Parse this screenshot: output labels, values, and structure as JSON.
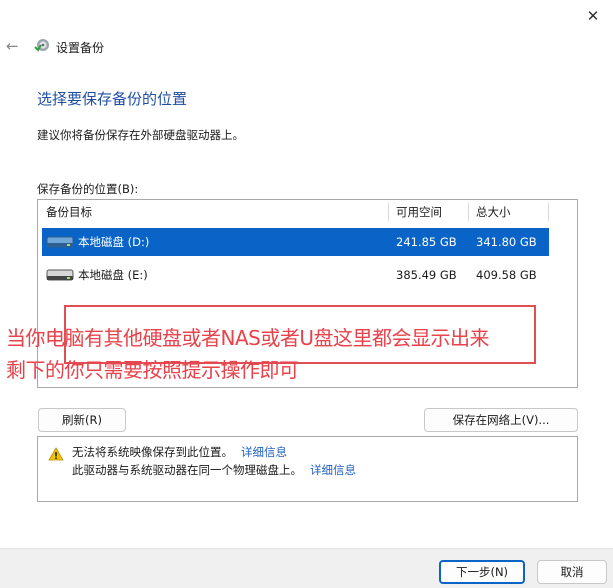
{
  "window": {
    "title": "设置备份",
    "close_glyph": "✕",
    "back_glyph": "←"
  },
  "page": {
    "heading": "选择要保存备份的位置",
    "description": "建议你将备份保存在外部硬盘驱动器上。",
    "list_label": "保存备份的位置(B):"
  },
  "table": {
    "headers": {
      "target": "备份目标",
      "free": "可用空间",
      "total": "总大小"
    },
    "rows": [
      {
        "name": "本地磁盘 (D:)",
        "free": "241.85 GB",
        "total": "341.80 GB",
        "selected": true
      },
      {
        "name": "本地磁盘 (E:)",
        "free": "385.49 GB",
        "total": "409.58 GB",
        "selected": false
      }
    ]
  },
  "annotation": {
    "line1": "当你电脑有其他硬盘或者NAS或者U盘这里都会显示出来",
    "line2": "剩下的你只需要按照提示操作即可",
    "color": "#e8424a"
  },
  "buttons": {
    "refresh": "刷新(R)",
    "save_network": "保存在网络上(V)...",
    "next": "下一步(N)",
    "cancel": "取消"
  },
  "warnings": [
    {
      "text": "无法将系统映像保存到此位置。",
      "link": "详细信息"
    },
    {
      "text": "此驱动器与系统驱动器在同一个物理磁盘上。",
      "link": "详细信息"
    }
  ],
  "colors": {
    "accent": "#0a64c8",
    "heading": "#1f4ea3",
    "link": "#1f5fbf",
    "warning": "#f2c200"
  },
  "icons": {
    "app": "backup-app-icon",
    "drive": "hard-drive-icon",
    "warning": "warning-triangle-icon"
  }
}
